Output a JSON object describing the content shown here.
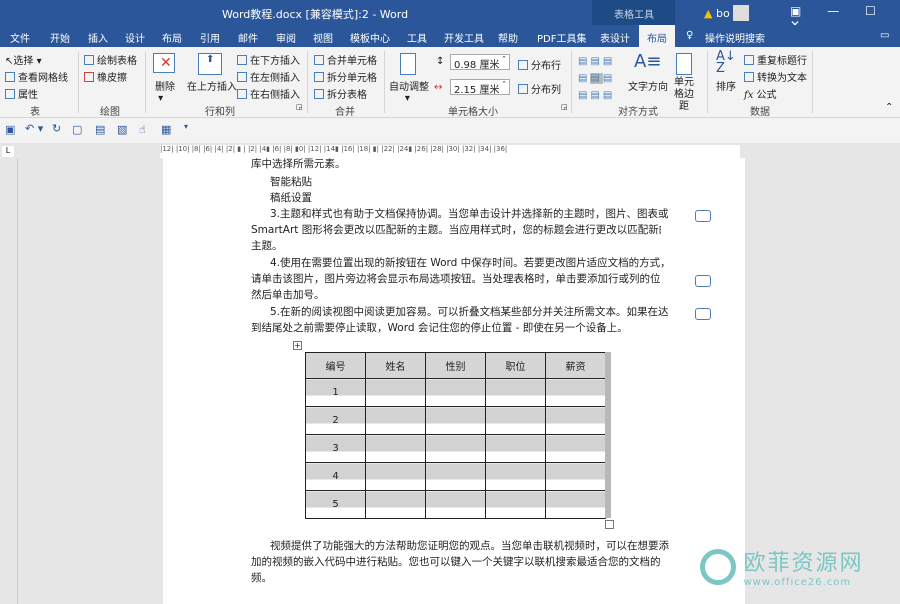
{
  "window": {
    "title": "Word教程.docx [兼容模式]:2  -  Word",
    "context_tab": "表格工具",
    "user": "bo"
  },
  "tabs": [
    "文件",
    "开始",
    "插入",
    "设计",
    "布局",
    "引用",
    "邮件",
    "审阅",
    "视图",
    "模板中心",
    "工具",
    "开发工具",
    "帮助",
    "PDF工具集",
    "表设计",
    "布局",
    "操作说明搜索"
  ],
  "ribbon": {
    "table": {
      "select": "选择",
      "gridlines": "查看网格线",
      "properties": "属性",
      "label": "表"
    },
    "draw": {
      "draw_table": "绘制表格",
      "eraser": "橡皮擦",
      "label": "绘图"
    },
    "rows_cols": {
      "delete": "删除",
      "insert_above": "在上方插入",
      "insert_below": "在下方插入",
      "insert_left": "在左侧插入",
      "insert_right": "在右侧插入",
      "label": "行和列"
    },
    "merge": {
      "merge_cells": "合并单元格",
      "split_cells": "拆分单元格",
      "split_table": "拆分表格",
      "label": "合并"
    },
    "cell_size": {
      "autofit": "自动调整",
      "height": "0.98 厘米",
      "width": "2.15 厘米",
      "dist_rows": "分布行",
      "dist_cols": "分布列",
      "label": "单元格大小"
    },
    "alignment": {
      "text_direction": "文字方向",
      "cell_margins": "单元格边距",
      "label": "对齐方式"
    },
    "data": {
      "sort": "排序",
      "repeat_header": "重复标题行",
      "convert_text": "转换为文本",
      "formula": "公式",
      "label": "数据"
    }
  },
  "ruler_labels": "|12| |10| |8| |6| |4| |2| ▮ | |2| |4▮ |6| |8| ▮0| |12| |14▮ |16| |18| ▮| |22| |24▮ |26| |28| |30| |32| |34| |36|",
  "document": {
    "lines": [
      "库中选择所需元素。",
      "智能粘贴",
      "稿纸设置",
      "3.主题和样式也有助于文档保持协调。当您单击设计并选择新的主题时，图片、图表或",
      "SmartArt 图形将会更改以匹配新的主题。当应用样式时，您的标题会进行更改以匹配新的",
      "主题。",
      "4.使用在需要位置出现的新按钮在 Word 中保存时间。若要更改图片适应文档的方式，",
      "请单击该图片，图片旁边将会显示布局选项按钮。当处理表格时，单击要添加行或列的位置，",
      "然后单击加号。",
      "5.在新的阅读视图中阅读更加容易。可以折叠文档某些部分并关注所需文本。如果在达",
      "到结尾处之前需要停止读取，Word 会记住您的停止位置 - 即使在另一个设备上。"
    ],
    "table": {
      "headers": [
        "编号",
        "姓名",
        "性别",
        "职位",
        "薪资"
      ],
      "rows": [
        "1",
        "2",
        "3",
        "4",
        "5"
      ]
    },
    "after": [
      "视频提供了功能强大的方法帮助您证明您的观点。当您单击联机视频时，可以在想要添",
      "加的视频的嵌入代码中进行粘贴。您也可以键入一个关键字以联机搜索最适合您的文档的视",
      "频。"
    ]
  },
  "watermark": {
    "name": "欧菲资源网",
    "url": "www.office26.com"
  }
}
